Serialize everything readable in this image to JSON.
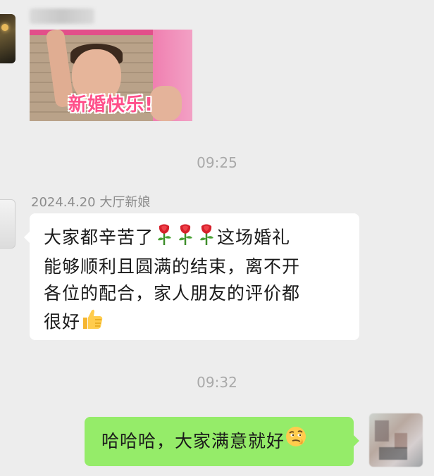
{
  "messages": [
    {
      "type": "image",
      "sender_blurred": true,
      "gif_caption": "新婚快乐!"
    },
    {
      "type": "time",
      "text": "09:25"
    },
    {
      "type": "text",
      "sender_name": "2024.4.20 大厅新娘",
      "lines": [
        "大家都辛苦了",
        "这场婚礼",
        "能够顺利且圆满的结束，离不开",
        "各位的配合，家人朋友的评价都",
        "很好"
      ],
      "emojis": [
        "rose-icon",
        "rose-icon",
        "rose-icon",
        "thumbs-up-icon"
      ]
    },
    {
      "type": "time",
      "text": "09:32"
    },
    {
      "type": "text",
      "self": true,
      "text": "哈哈哈，大家满意就好",
      "emoji": "thinking-face-icon"
    }
  ],
  "colors": {
    "background": "#ededed",
    "self_bubble": "#95ec69",
    "other_bubble": "#ffffff",
    "timestamp": "#a9a9a9"
  }
}
